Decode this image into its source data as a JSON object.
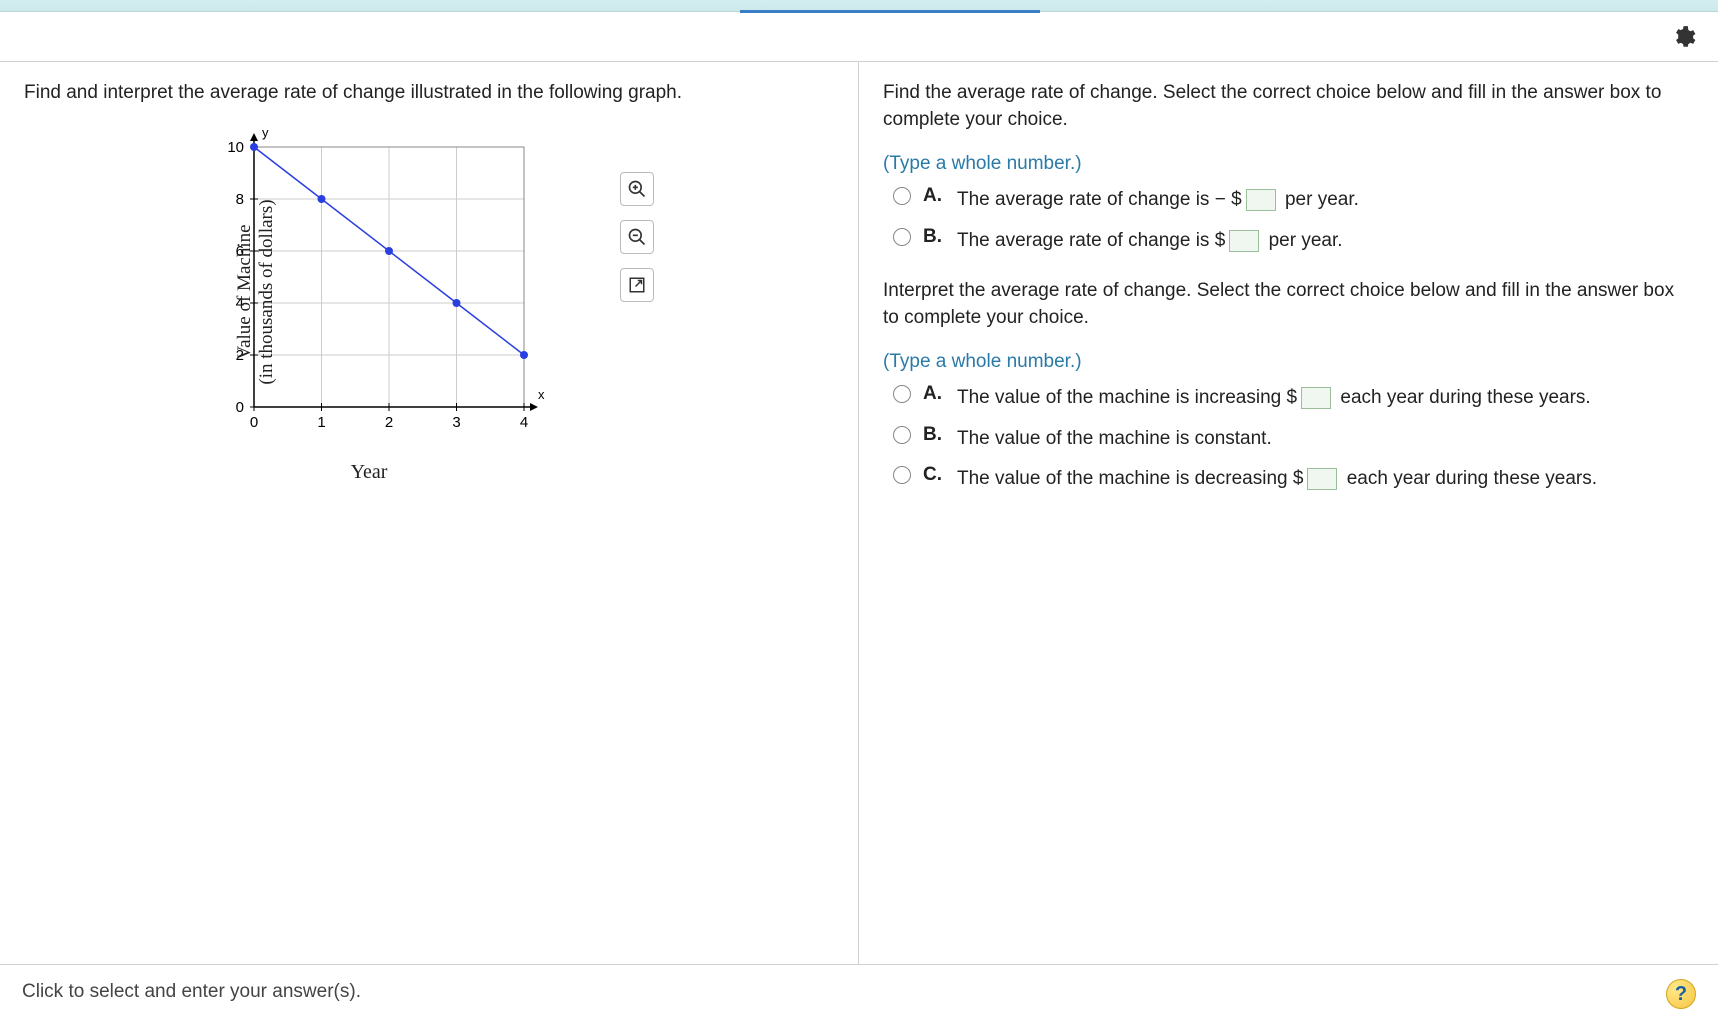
{
  "question_left": "Find and interpret the average rate of change illustrated in the following graph.",
  "right": {
    "prompt1": "Find the average rate of change. Select the correct choice below and fill in the answer box to complete your choice.",
    "hint1": "(Type a whole number.)",
    "q1": {
      "A": {
        "label": "A.",
        "pre": "The average rate of change is ",
        "neg": " − $",
        "post": " per year."
      },
      "B": {
        "label": "B.",
        "pre": "The average rate of change is $",
        "post": " per year."
      }
    },
    "prompt2": "Interpret the average rate of change. Select the correct choice below and fill in the answer box to complete your choice.",
    "hint2": "(Type a whole number.)",
    "q2": {
      "A": {
        "label": "A.",
        "pre": "The value of the machine is increasing $",
        "post": " each year during these years."
      },
      "B": {
        "label": "B.",
        "text": "The value of the machine is constant."
      },
      "C": {
        "label": "C.",
        "pre": "The value of the machine is decreasing $",
        "post": " each year during these years."
      }
    }
  },
  "footer": "Click to select and enter your answer(s).",
  "help": "?",
  "chart_data": {
    "type": "line",
    "x": [
      0,
      1,
      2,
      3,
      4
    ],
    "y": [
      10,
      8,
      6,
      4,
      2
    ],
    "xlabel": "Year",
    "ylabel_line1": "Value of Machine",
    "ylabel_line2": "(in thousands of dollars)",
    "xlim": [
      0,
      4
    ],
    "ylim": [
      0,
      10
    ],
    "xticks": [
      0,
      1,
      2,
      3,
      4
    ],
    "yticks": [
      0,
      2,
      4,
      6,
      8,
      10
    ],
    "y_axis_letter": "y",
    "x_axis_letter": "x"
  }
}
